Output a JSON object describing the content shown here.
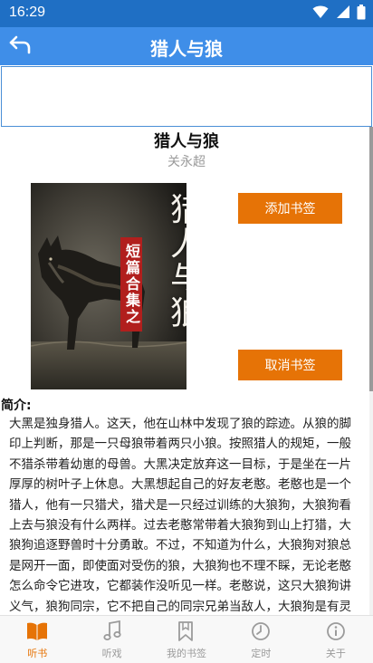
{
  "status_bar": {
    "time": "16:29"
  },
  "app_bar": {
    "title": "猎人与狼",
    "back_icon": "back-arrow-icon"
  },
  "book": {
    "title": "猎人与狼",
    "author": "关永超",
    "cover_title": "猎人与狼",
    "cover_subtitle": "短篇合集之"
  },
  "actions": {
    "add_bookmark": "添加书签",
    "remove_bookmark": "取消书签"
  },
  "intro": {
    "label": "简介:",
    "text": "大黑是独身猎人。这天，他在山林中发现了狼的踪迹。从狼的脚印上判断，那是一只母狼带着两只小狼。按照猎人的规矩，一般不猎杀带着幼崽的母兽。大黑决定放弃这一目标，于是坐在一片厚厚的树叶子上休息。大黑想起自己的好友老憨。老憨也是一个猎人，他有一只猎犬，猎犬是一只经过训练的大狼狗，大狼狗看上去与狼没有什么两样。过去老憨常带着大狼狗到山上打猎，大狼狗追逐野兽时十分勇敢。不过，不知道为什么，大狼狗对狼总是网开一面，即使面对受伤的狼，大狼狗也不理不睬，无论老憨怎么命令它进攻，它都装作没听见一样。老憨说，这只大狼狗讲义气，狼狗同宗，它不把自己的同宗兄弟当敌人，大狼狗是有灵气的。由于这个缘故，老憨从不猎狼。可是天有不测风云，人有"
  },
  "bottom_nav": {
    "items": [
      {
        "label": "听书",
        "icon": "book-open-icon",
        "active": true
      },
      {
        "label": "听戏",
        "icon": "music-note-icon",
        "active": false
      },
      {
        "label": "我的书签",
        "icon": "bookmark-icon",
        "active": false
      },
      {
        "label": "定时",
        "icon": "timer-icon",
        "active": false
      },
      {
        "label": "关于",
        "icon": "info-icon",
        "active": false
      }
    ]
  },
  "colors": {
    "status_bar": "#1f6fc4",
    "app_bar": "#3f8ee8",
    "accent_orange": "#e67306",
    "nav_inactive": "#9b9b9b"
  }
}
